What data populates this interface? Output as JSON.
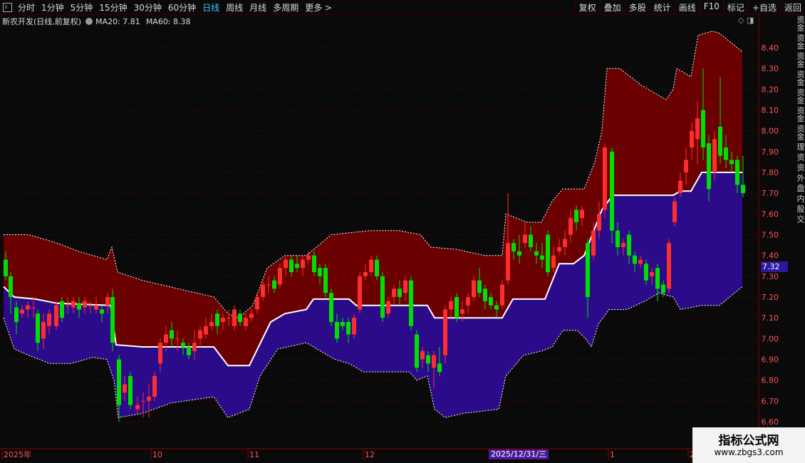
{
  "toolbar": {
    "periods": [
      "分时",
      "1分钟",
      "5分钟",
      "15分钟",
      "30分钟",
      "60分钟",
      "日线",
      "周线",
      "月线",
      "多周期",
      "更多 >"
    ],
    "active_period": "日线",
    "right_buttons": [
      "复权",
      "叠加",
      "多股",
      "统计",
      "画线",
      "F10",
      "标记",
      "+自选",
      "返回"
    ]
  },
  "info": {
    "title": "新农开发(日线,前复权)",
    "ma20_label": "MA20: 7.81",
    "ma60_label": "MA60: 8.38"
  },
  "price_axis": {
    "ticks": [
      "8.40",
      "8.30",
      "8.20",
      "8.10",
      "8.00",
      "7.90",
      "7.80",
      "7.70",
      "7.60",
      "7.50",
      "7.40",
      "7.30",
      "7.20",
      "7.10",
      "7.00",
      "6.90",
      "6.80",
      "6.70",
      "6.60"
    ],
    "current_price": "7.32"
  },
  "date_axis": {
    "labels": [
      "2025年",
      "10",
      "11",
      "12",
      "1",
      "2"
    ],
    "highlight": "2025/12/31/三"
  },
  "side_text": "资金 资金 资金 资金 资金 资金 资金 理 资 资 外 盘 内 股 交",
  "watermark": {
    "line1": "指标公式网",
    "line2": "www.zbgs3.com"
  },
  "colors": {
    "up": "#ff2d2d",
    "down": "#00e000",
    "upper_band": "#6a0000",
    "lower_band": "#2b0b8a",
    "midline": "#ffffff",
    "grid": "#5a0000",
    "axis_text": "#ff5555"
  }
}
